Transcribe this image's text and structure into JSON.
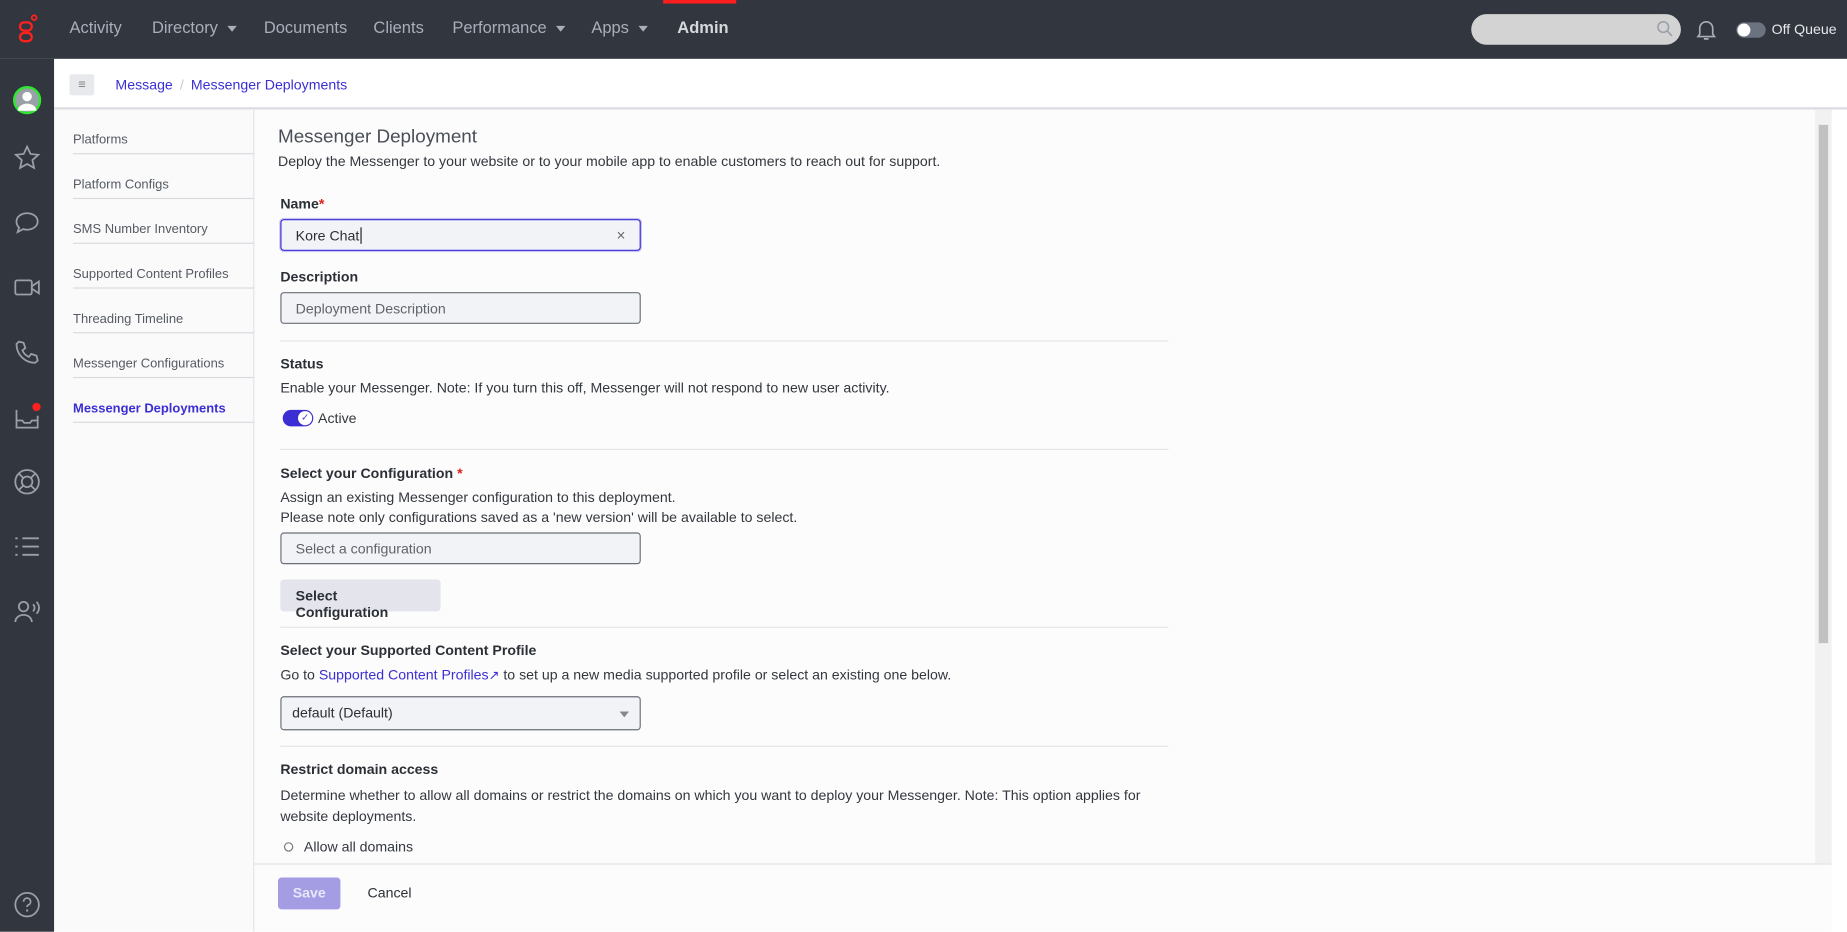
{
  "topnav": {
    "items": [
      {
        "label": "Activity"
      },
      {
        "label": "Directory"
      },
      {
        "label": "Documents"
      },
      {
        "label": "Clients"
      },
      {
        "label": "Performance"
      },
      {
        "label": "Apps"
      },
      {
        "label": "Admin"
      }
    ],
    "queue_label": "Off Queue",
    "search_placeholder": ""
  },
  "breadcrumb": {
    "items": [
      "Message",
      "Messenger Deployments"
    ],
    "separator": "/"
  },
  "leftnav": {
    "items": [
      "Platforms",
      "Platform Configs",
      "SMS Number Inventory",
      "Supported Content Profiles",
      "Threading Timeline",
      "Messenger Configurations",
      "Messenger Deployments"
    ],
    "selected": "Messenger Deployments"
  },
  "form": {
    "title": "Messenger Deployment",
    "subtitle": "Deploy the Messenger to your website or to your mobile app to enable customers to reach out for support.",
    "name_label": "Name",
    "required_mark": "*",
    "name_value": "Kore Chat",
    "clear_icon": "×",
    "description_label": "Description",
    "description_placeholder": "Deployment Description",
    "status_label": "Status",
    "status_desc": "Enable your Messenger. Note: If you turn this off, Messenger will not respond to new user activity.",
    "status_toggle": "Active",
    "config_label": "Select your Configuration",
    "config_desc1": "Assign an existing Messenger configuration to this deployment.",
    "config_desc2": "Please note only configurations saved as a 'new version' will be available to select.",
    "config_placeholder": "Select a configuration",
    "config_button": "Select Configuration",
    "profile_label": "Select your Supported Content Profile",
    "profile_pre": "Go to ",
    "profile_link": "Supported Content Profiles",
    "profile_post": " to set up a new media supported profile or select an existing one below.",
    "profile_selected": "default (Default)",
    "domain_label": "Restrict domain access",
    "domain_desc": "Determine whether to allow all domains or restrict the domains on which you want to deploy your Messenger. Note: This option applies for website deployments.",
    "domain_option": "Allow all domains"
  },
  "footer": {
    "save": "Save",
    "cancel": "Cancel"
  },
  "colors": {
    "accent": "#3b2ed3",
    "header": "#32363f",
    "brand": "#ff1e1e"
  }
}
